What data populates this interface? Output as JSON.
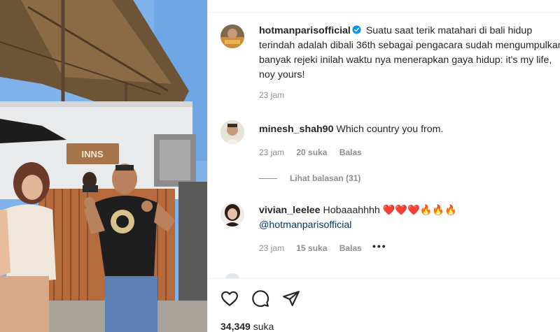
{
  "post": {
    "username": "hotmanparisofficial",
    "caption": "Suatu saat terik matahari di bali hidup terindah adalah dibali 36th sebagai pengacara sudah mengumpulkan banyak rejeki inilah waktu nya menerapkan gaya hidup: it's my life, noy yours!",
    "time": "23 jam"
  },
  "media": {
    "sign_text": "INNS"
  },
  "comments": [
    {
      "username": "minesh_shah90",
      "text": "Which country you from.",
      "time": "23 jam",
      "likes": "20 suka",
      "reply": "Balas"
    },
    {
      "username": "vivian_leelee",
      "text": "Hobaaahhhh",
      "emojis": "❤️❤️❤️🔥🔥🔥",
      "mention": "@hotmanparisofficial",
      "time": "23 jam",
      "likes": "15 suka",
      "reply": "Balas"
    }
  ],
  "view_replies": "Lihat balasan (31)",
  "more_label": "•••",
  "footer": {
    "like_count": "34,349",
    "like_word": "suka"
  },
  "icons": {
    "like": "heart-icon",
    "comment": "comment-icon",
    "share": "send-icon",
    "verified": "verified-badge-icon"
  },
  "colors": {
    "text": "#262626",
    "secondary": "#8e8e8e",
    "link": "#00376b",
    "verified": "#0095f6"
  }
}
